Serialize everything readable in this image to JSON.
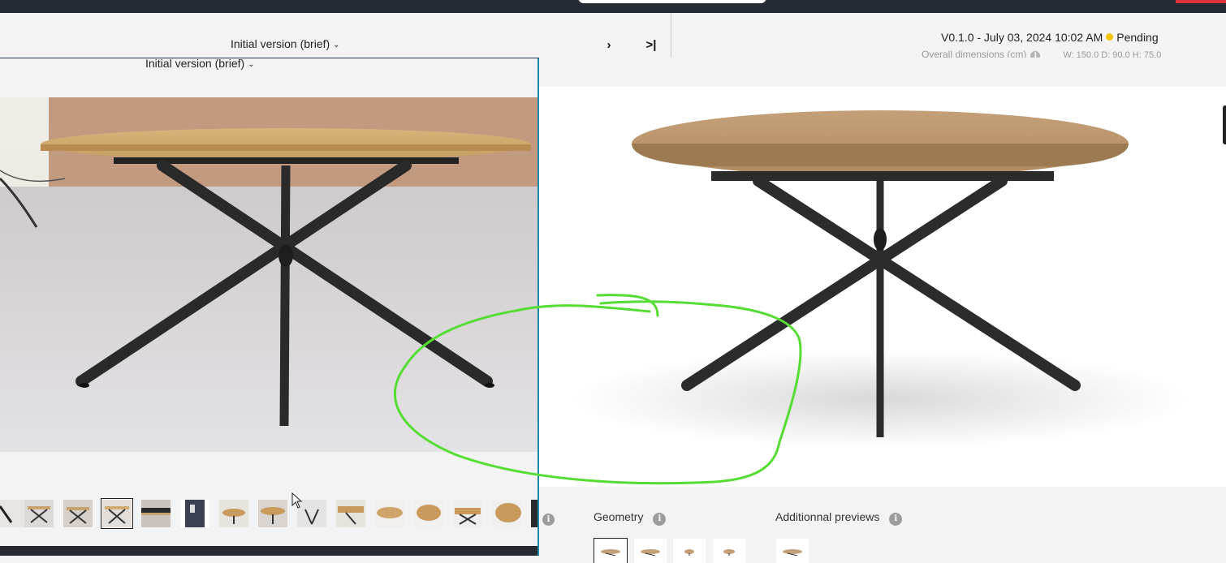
{
  "header": {
    "version_label": "Initial version (brief)",
    "version_meta": "V0.1.0 - July 03, 2024 10:02 AM",
    "status": "Pending",
    "status_color": "#f3c300",
    "dims_label": "Overall dimensions (cm)",
    "dims_values": "W: 150.0   D: 90.0   H: 75.0",
    "next_icon": "chevron-right-icon",
    "last_icon": "skip-to-end-icon"
  },
  "left_panel": {
    "title": "Initial version (brief)",
    "thumb_count": 14,
    "selected_thumb_index": 3
  },
  "right_panel": {
    "geometry_label": "Geometry",
    "previews_label": "Additionnal previews"
  },
  "colors": {
    "accent_divider": "#1b8aa8",
    "annotation": "#55dd33"
  }
}
